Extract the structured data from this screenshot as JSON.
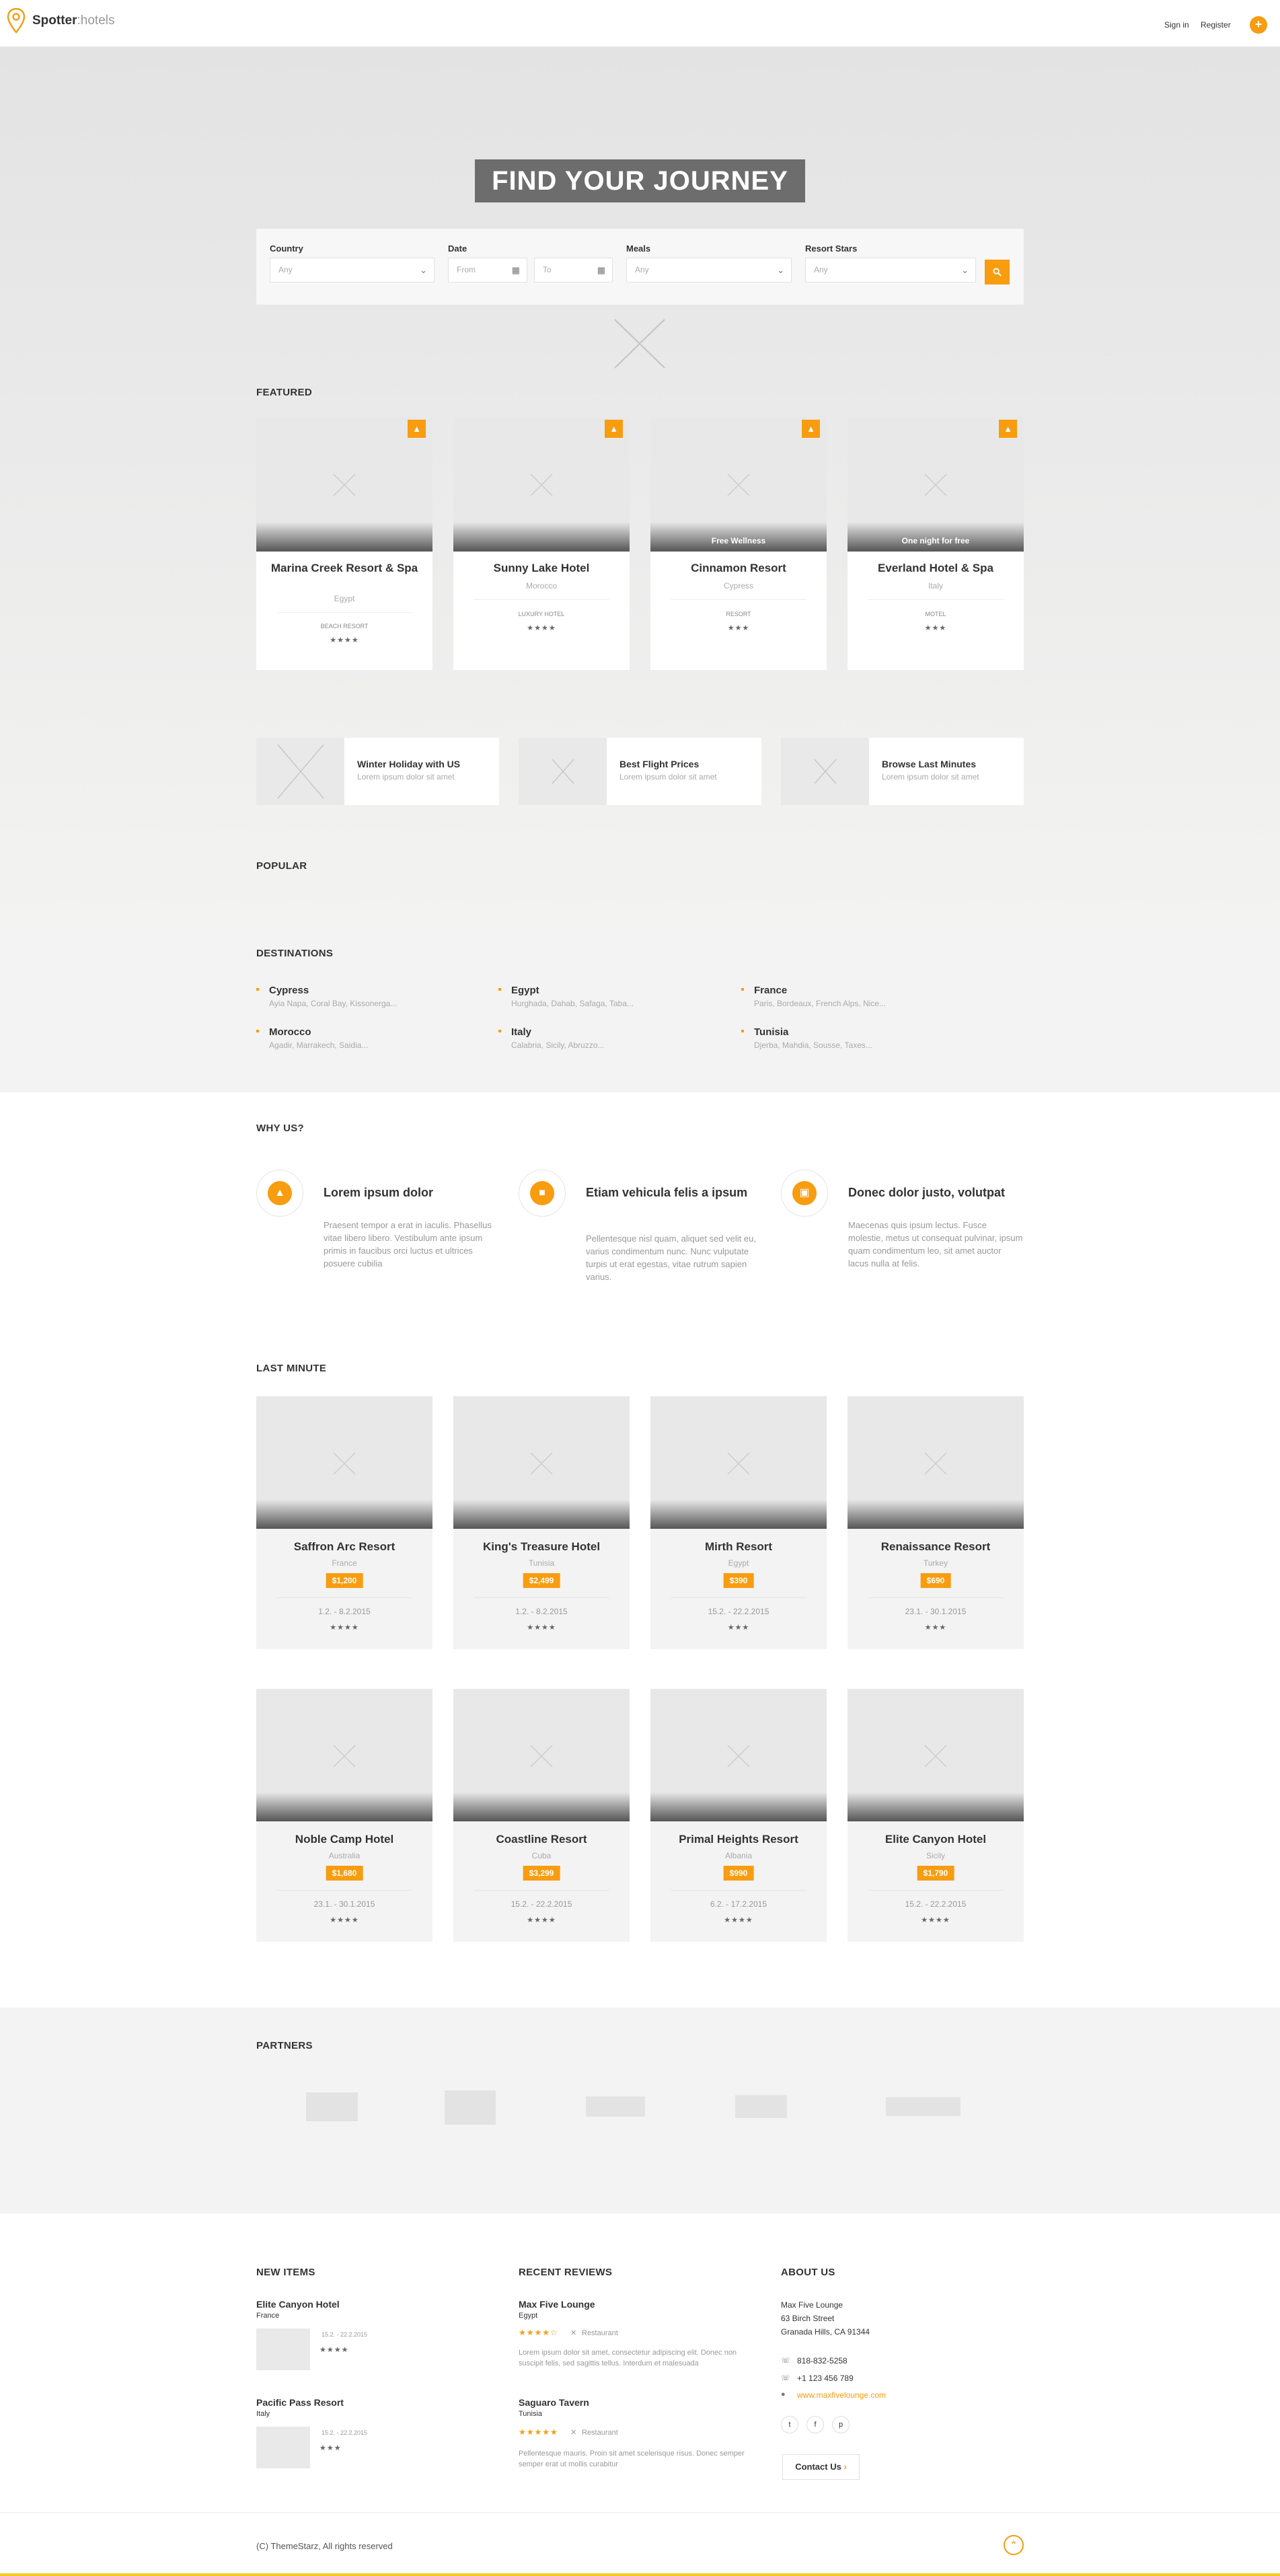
{
  "header": {
    "brand": "Spotter",
    "brand_suffix": ":hotels",
    "sign_in": "Sign in",
    "register": "Register",
    "plus": "+"
  },
  "hero": {
    "title": "FIND YOUR JOURNEY"
  },
  "search": {
    "country_label": "Country",
    "country_value": "Any",
    "date_label": "Date",
    "date_from": "From",
    "date_to": "To",
    "meals_label": "Meals",
    "meals_value": "Any",
    "stars_label": "Resort Stars",
    "stars_value": "Any"
  },
  "featured": {
    "title": "FEATURED",
    "items": [
      {
        "name": "Marina Creek Resort & Spa",
        "location": "Egypt",
        "ribbon": "",
        "type": "BEACH RESORT",
        "stars": "★★★★"
      },
      {
        "name": "Sunny Lake Hotel",
        "location": "Morocco",
        "ribbon": "",
        "type": "LUXURY HOTEL",
        "stars": "★★★★"
      },
      {
        "name": "Cinnamon Resort",
        "location": "Cypress",
        "ribbon": "Free Wellness",
        "type": "RESORT",
        "stars": "★★★"
      },
      {
        "name": "Everland Hotel & Spa",
        "location": "Italy",
        "ribbon": "One night for free",
        "type": "MOTEL",
        "stars": "★★★"
      }
    ]
  },
  "promos": [
    {
      "title": "Winter Holiday with US",
      "subtitle": "Lorem ipsum dolor sit amet"
    },
    {
      "title": "Best Flight Prices",
      "subtitle": "Lorem ipsum dolor sit amet"
    },
    {
      "title": "Browse Last Minutes",
      "subtitle": "Lorem ipsum dolor sit amet"
    }
  ],
  "popular": {
    "title": "POPULAR"
  },
  "destinations": {
    "title": "DESTINATIONS",
    "items": [
      {
        "name": "Cypress",
        "cities": "Ayia Napa, Coral Bay, Kissonerga..."
      },
      {
        "name": "Egypt",
        "cities": "Hurghada, Dahab, Safaga, Taba..."
      },
      {
        "name": "France",
        "cities": "Paris, Bordeaux, French Alps, Nice..."
      },
      {
        "name": "Morocco",
        "cities": "Agadir, Marrakech, Saidia..."
      },
      {
        "name": "Italy",
        "cities": "Calabria, Sicily, Abruzzo..."
      },
      {
        "name": "Tunisia",
        "cities": "Djerba, Mahdia, Sousse, Taxes..."
      }
    ]
  },
  "why": {
    "title": "WHY US?",
    "items": [
      {
        "icon": "thumbs-up-icon",
        "title": "Lorem ipsum dolor",
        "desc": "Praesent tempor a erat in iaculis. Phasellus vitae libero libero. Vestibulum ante ipsum primis in faucibus orci luctus et ultrices posuere cubilia"
      },
      {
        "icon": "folder-icon",
        "title": "Etiam vehicula felis a ipsum",
        "desc": "Pellentesque nisl quam, aliquet sed velit eu, varius condimentum nunc. Nunc vulputate turpis ut erat egestas, vitae rutrum sapien varius."
      },
      {
        "icon": "money-icon",
        "title": "Donec dolor justo, volutpat",
        "desc": "Maecenas quis ipsum lectus. Fusce molestie, metus ut consequat pulvinar, ipsum quam condimentum leo, sit amet auctor lacus nulla at felis."
      }
    ]
  },
  "last_minute": {
    "title": "LAST MINUTE",
    "items": [
      {
        "name": "Saffron Arc Resort",
        "location": "France",
        "price": "$1,200",
        "dates": "1.2. - 8.2.2015",
        "stars": "★★★★"
      },
      {
        "name": "King's Treasure Hotel",
        "location": "Tunisia",
        "price": "$2,499",
        "dates": "1.2. - 8.2.2015",
        "stars": "★★★★"
      },
      {
        "name": "Mirth Resort",
        "location": "Egypt",
        "price": "$390",
        "dates": "15.2. - 22.2.2015",
        "stars": "★★★"
      },
      {
        "name": "Renaissance Resort",
        "location": "Turkey",
        "price": "$690",
        "dates": "23.1. - 30.1.2015",
        "stars": "★★★"
      },
      {
        "name": "Noble Camp Hotel",
        "location": "Australia",
        "price": "$1,680",
        "dates": "23.1. - 30.1.2015",
        "stars": "★★★★"
      },
      {
        "name": "Coastline Resort",
        "location": "Cuba",
        "price": "$3,299",
        "dates": "15.2. - 22.2.2015",
        "stars": "★★★★"
      },
      {
        "name": "Primal Heights Resort",
        "location": "Albania",
        "price": "$990",
        "dates": "6.2. - 17.2.2015",
        "stars": "★★★★"
      },
      {
        "name": "Elite Canyon Hotel",
        "location": "Sicily",
        "price": "$1,790",
        "dates": "15.2. - 22.2.2015",
        "stars": "★★★★"
      }
    ]
  },
  "partners": {
    "title": "PARTNERS"
  },
  "footer": {
    "new_items": {
      "title": "NEW ITEMS",
      "items": [
        {
          "name": "Elite Canyon Hotel",
          "country": "France",
          "dates": "15.2. - 22.2.2015",
          "stars": "★★★★"
        },
        {
          "name": "Pacific Pass Resort",
          "country": "Italy",
          "dates": "15.2. - 22.2.2015",
          "stars": "★★★"
        }
      ]
    },
    "recent_reviews": {
      "title": "RECENT REVIEWS",
      "items": [
        {
          "name": "Max Five Lounge",
          "country": "Egypt",
          "rating": "★★★★☆",
          "category": "Restaurant",
          "text": "Lorem ipsum dolor sit amet, consectetur adipiscing elit. Donec non suscipit felis, sed sagittis tellus. Interdum et malesuada"
        },
        {
          "name": "Saguaro Tavern",
          "country": "Tunisia",
          "rating": "★★★★★",
          "category": "Restaurant",
          "text": "Pellentesque mauris. Proin sit amet scelerisque risus. Donec semper semper erat ut mollis curabitur"
        }
      ]
    },
    "about": {
      "title": "ABOUT US",
      "name": "Max Five Lounge",
      "street": "63 Birch Street",
      "city": "Granada Hills, CA 91344",
      "phone1": "818-832-5258",
      "phone2": "+1 123 456 789",
      "website": "www.maxfivelounge.com",
      "contact_button": "Contact Us"
    },
    "copyright": "(C) ThemeStarz, All rights reserved"
  },
  "colors": {
    "accent": "#f89c10",
    "bar": "#f2cd20"
  }
}
